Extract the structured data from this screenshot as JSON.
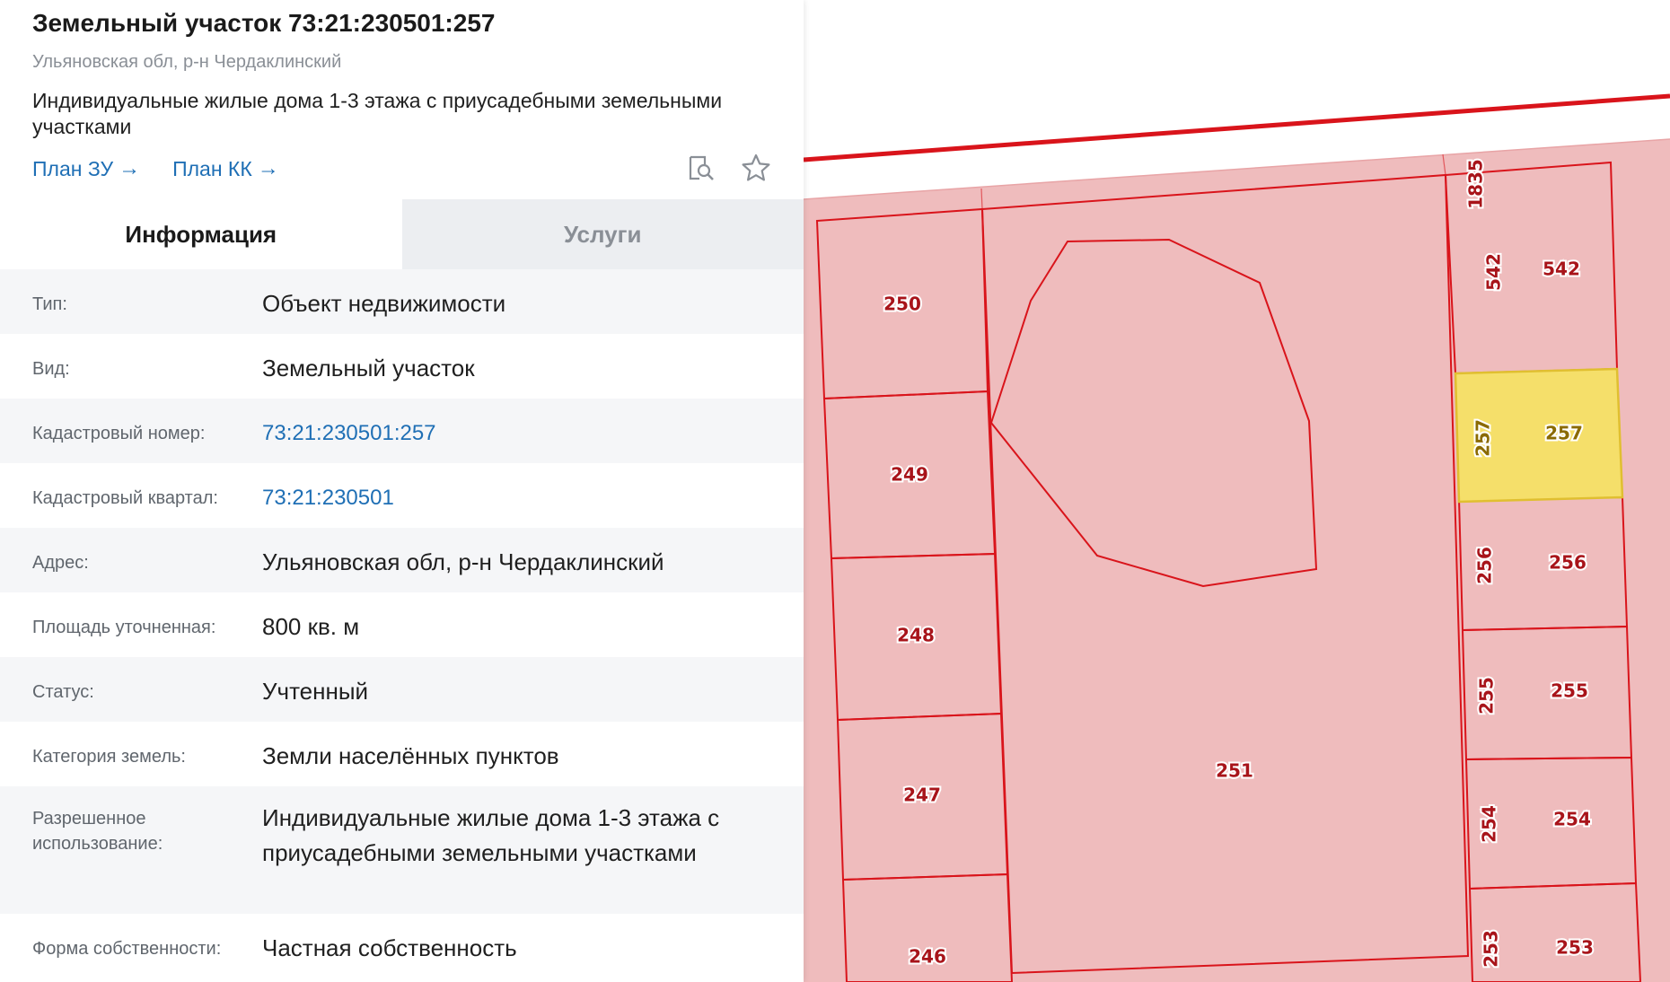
{
  "header": {
    "title": "Земельный участок 73:21:230501:257",
    "subtitle": "Ульяновская обл, р-н Чердаклинский",
    "description": "Индивидуальные жилые дома 1-3 этажа с приусадебными земельными участками",
    "links": [
      {
        "label": "План ЗУ"
      },
      {
        "label": "План КК"
      }
    ],
    "link_arrow": "→",
    "icons": [
      "search-document-icon",
      "star-icon"
    ],
    "link_color": "#1f6fb5"
  },
  "tabs": [
    {
      "label": "Информация",
      "active": true
    },
    {
      "label": "Услуги",
      "active": false
    }
  ],
  "info": {
    "type_label": "Тип:",
    "type_value": "Объект недвижимости",
    "kind_label": "Вид:",
    "kind_value": "Земельный участок",
    "cad_number_label": "Кадастровый номер:",
    "cad_number_value": "73:21:230501:257",
    "cad_quarter_label": "Кадастровый квартал:",
    "cad_quarter_value": "73:21:230501",
    "address_label": "Адрес:",
    "address_value": "Ульяновская обл, р-н Чердаклинский",
    "area_label": "Площадь уточненная:",
    "area_value": "800 кв. м",
    "status_label": "Статус:",
    "status_value": "Учтенный",
    "category_label": "Категория земель:",
    "category_value": "Земли населённых пунктов",
    "usage_label": "Разрешенное использование:",
    "usage_value": "Индивидуальные жилые дома 1-3 этажа с приусадебными земельными участками",
    "ownership_label": "Форма собственности:",
    "ownership_value": "Частная собственность"
  },
  "map": {
    "colors": {
      "fill": "#efbcbd",
      "border": "#d9141b",
      "highlight": "#f5df6a",
      "label_text": "#a8141a"
    },
    "parcel_labels": [
      "250",
      "249",
      "248",
      "247",
      "246",
      "251",
      "1835",
      "542",
      "257",
      "256",
      "255",
      "254",
      "253"
    ]
  }
}
